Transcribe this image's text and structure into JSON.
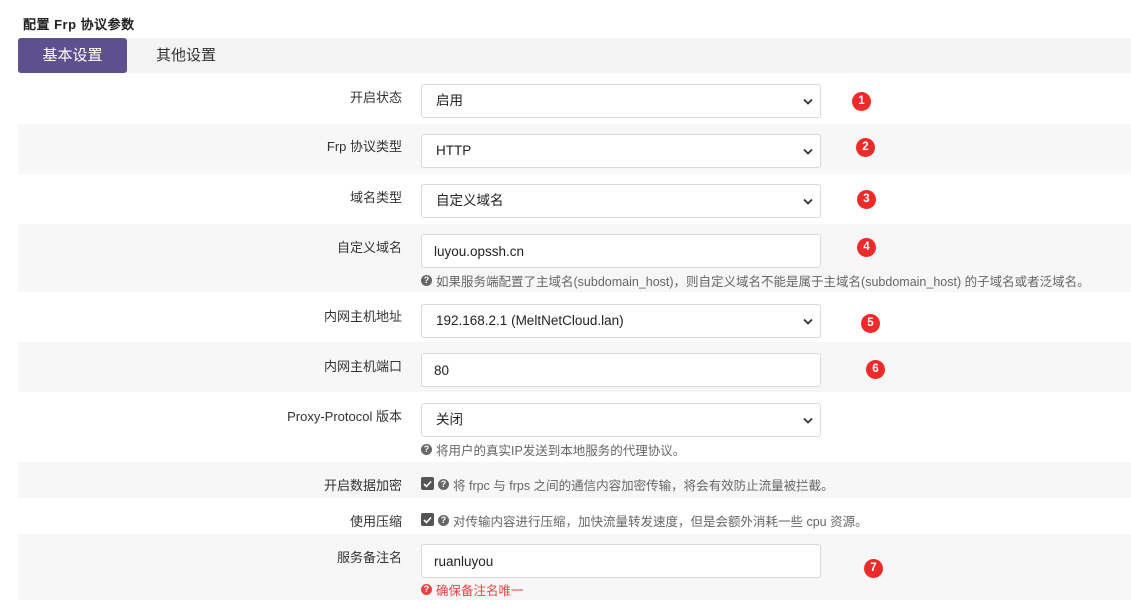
{
  "page_title": "配置 Frp 协议参数",
  "tabs": [
    {
      "label": "基本设置",
      "active": true
    },
    {
      "label": "其他设置",
      "active": false
    }
  ],
  "fields": {
    "enable_status": {
      "label": "开启状态",
      "value": "启用",
      "badge": "1"
    },
    "protocol_type": {
      "label": "Frp 协议类型",
      "value": "HTTP",
      "badge": "2"
    },
    "domain_type": {
      "label": "域名类型",
      "value": "自定义域名",
      "badge": "3"
    },
    "custom_domain": {
      "label": "自定义域名",
      "value": "luyou.opssh.cn",
      "badge": "4",
      "help": "如果服务端配置了主域名(subdomain_host)，则自定义域名不能是属于主域名(subdomain_host) 的子域名或者泛域名。"
    },
    "local_host": {
      "label": "内网主机地址",
      "value": "192.168.2.1 (MeltNetCloud.lan)",
      "badge": "5"
    },
    "local_port": {
      "label": "内网主机端口",
      "value": "80",
      "badge": "6"
    },
    "proxy_protocol": {
      "label": "Proxy-Protocol 版本",
      "value": "关闭",
      "help": "将用户的真实IP发送到本地服务的代理协议。"
    },
    "encryption": {
      "label": "开启数据加密",
      "checked": true,
      "help": "将 frpc 与 frps 之间的通信内容加密传输，将会有效防止流量被拦截。"
    },
    "compression": {
      "label": "使用压缩",
      "checked": true,
      "help": "对传输内容进行压缩，加快流量转发速度，但是会额外消耗一些 cpu 资源。"
    },
    "service_remark": {
      "label": "服务备注名",
      "value": "ruanluyou",
      "badge": "7",
      "warn": "确保备注名唯一"
    }
  },
  "help_icon_glyph": "?",
  "colors": {
    "accent": "#5e4f8f",
    "badge": "#ee2a2a",
    "warn": "#e64545"
  }
}
